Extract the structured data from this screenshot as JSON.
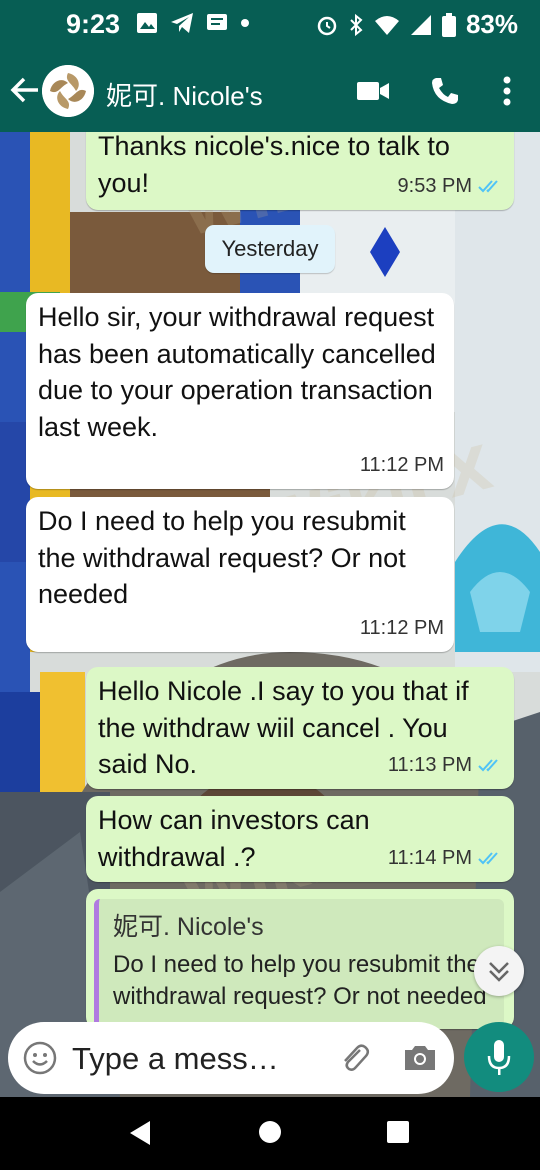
{
  "status_bar": {
    "time": "9:23",
    "battery": "83%"
  },
  "header": {
    "contact_name": "妮可. Nicole's"
  },
  "messages": [
    {
      "text": "Thanks nicole's.nice to talk to you!",
      "time": "9:53 PM",
      "direction": "outgoing"
    },
    {
      "text": "Hello sir, your withdrawal request has been automatically cancelled due to your operation transaction last week.",
      "time": "11:12 PM",
      "direction": "incoming"
    },
    {
      "text": "Do I need to help you resubmit the withdrawal request? Or not needed",
      "time": "11:12 PM",
      "direction": "incoming"
    },
    {
      "text": "Hello Nicole .I say to you that if the withdraw wiil cancel . You said No.",
      "time": "11:13 PM",
      "direction": "outgoing"
    },
    {
      "text": "How can investors  can withdrawal .?",
      "time": "11:14 PM",
      "direction": "outgoing"
    }
  ],
  "date_separator": "Yesterday",
  "quoted_reply": {
    "name": "妮可. Nicole's",
    "text": "Do I need to help you resubmit the withdrawal request? Or not needed"
  },
  "composer": {
    "placeholder": "Type a mess…"
  },
  "watermark": "WikiFX",
  "colors": {
    "header": "#075E54",
    "outgoing_bubble": "#DCF8C6",
    "incoming_bubble": "#FFFFFF",
    "mic_button": "#128C7E",
    "read_ticks": "#4FC3F7"
  },
  "icons": [
    "back-arrow-icon",
    "video-call-icon",
    "phone-icon",
    "more-icon",
    "emoji-icon",
    "attach-icon",
    "camera-icon",
    "mic-icon",
    "scroll-down-icon",
    "read-ticks-icon"
  ]
}
